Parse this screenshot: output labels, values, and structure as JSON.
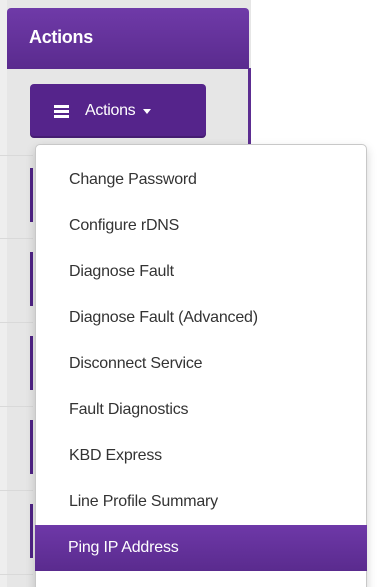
{
  "column": {
    "header_label": "Actions"
  },
  "actions_button": {
    "label": "Actions",
    "menu_icon": "hamburger-icon",
    "caret_icon": "caret-down-icon"
  },
  "menu": {
    "items": [
      {
        "label": "Change Password"
      },
      {
        "label": "Configure rDNS"
      },
      {
        "label": "Diagnose Fault"
      },
      {
        "label": "Diagnose Fault (Advanced)"
      },
      {
        "label": "Disconnect Service"
      },
      {
        "label": "Fault Diagnostics"
      },
      {
        "label": "KBD Express"
      },
      {
        "label": "Line Profile Summary"
      },
      {
        "label": "Ping IP Address"
      }
    ],
    "active_index": 8
  },
  "colors": {
    "accent_purple": "#5a2b8e",
    "header_purple": "#6f3aa8",
    "panel_gray": "#e6e6e6",
    "menu_text": "#333333"
  }
}
